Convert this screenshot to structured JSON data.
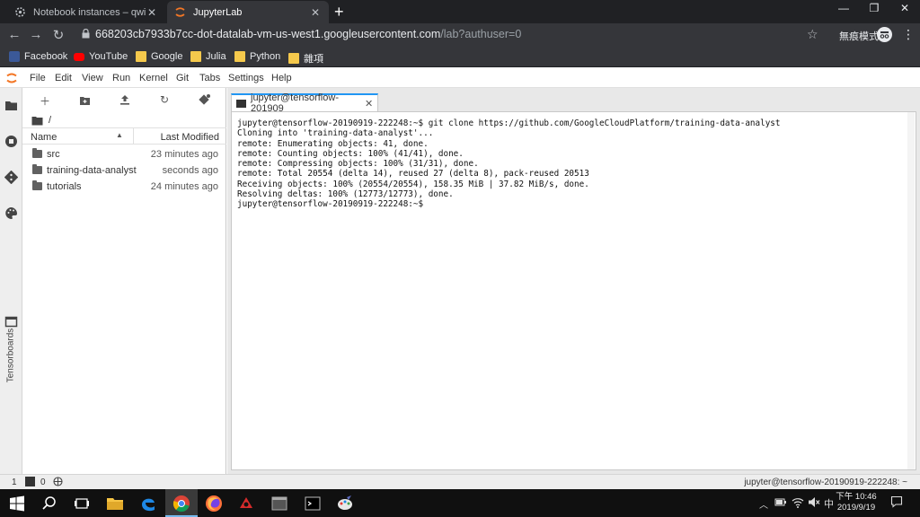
{
  "browser": {
    "tabs": [
      {
        "title": "Notebook instances – qwiklabs",
        "close": "✕"
      },
      {
        "title": "JupyterLab",
        "close": "✕"
      }
    ],
    "new_tab": "+",
    "window_controls": {
      "minimize": "—",
      "restore": "❐",
      "close": "✕"
    },
    "url_host": "668203cb7933b7cc-dot-datalab-vm-us-west1.googleusercontent.com",
    "url_path": "/lab?authuser=0",
    "incognito_label": "無痕模式",
    "bookmarks": [
      "Facebook",
      "YouTube",
      "Google",
      "Julia",
      "Python",
      "雜項"
    ]
  },
  "jupyter": {
    "menu": [
      "File",
      "Edit",
      "View",
      "Run",
      "Kernel",
      "Git",
      "Tabs",
      "Settings",
      "Help"
    ],
    "activity_vertical_label": "Tensorboards",
    "file_browser": {
      "path": "/",
      "column_name": "Name",
      "column_modified": "Last Modified",
      "items": [
        {
          "name": "src",
          "modified": "23 minutes ago"
        },
        {
          "name": "training-data-analyst",
          "modified": "seconds ago"
        },
        {
          "name": "tutorials",
          "modified": "24 minutes ago"
        }
      ]
    },
    "doc_tab": {
      "title": "jupyter@tensorflow-201909",
      "close": "✕"
    },
    "terminal_lines": [
      "jupyter@tensorflow-20190919-222248:~$ git clone https://github.com/GoogleCloudPlatform/training-data-analyst",
      "Cloning into 'training-data-analyst'...",
      "remote: Enumerating objects: 41, done.",
      "remote: Counting objects: 100% (41/41), done.",
      "remote: Compressing objects: 100% (31/31), done.",
      "remote: Total 20554 (delta 14), reused 27 (delta 8), pack-reused 20513",
      "Receiving objects: 100% (20554/20554), 158.35 MiB | 37.82 MiB/s, done.",
      "Resolving deltas: 100% (12773/12773), done.",
      "jupyter@tensorflow-20190919-222248:~$"
    ],
    "status": {
      "count_1": "1",
      "count_2": "0",
      "right": "jupyter@tensorflow-20190919-222248: ~"
    }
  },
  "taskbar": {
    "ime": "中",
    "time": "下午 10:46",
    "date": "2019/9/19"
  },
  "colors": {
    "chrome_dark": "#202124",
    "chrome_toolbar": "#35363a",
    "jupyter_accent": "#2196f3",
    "jupyter_orange": "#f37726"
  }
}
